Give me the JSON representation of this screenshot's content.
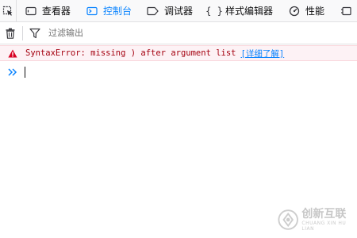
{
  "devtools": {
    "tabs": [
      {
        "id": "inspector",
        "label": "查看器",
        "icon": "inspector-icon",
        "selected": false
      },
      {
        "id": "console",
        "label": "控制台",
        "icon": "console-icon",
        "selected": true
      },
      {
        "id": "debugger",
        "label": "调试器",
        "icon": "debugger-icon",
        "selected": false
      },
      {
        "id": "style-editor",
        "label": "样式编辑器",
        "icon": "braces-icon",
        "selected": false
      },
      {
        "id": "performance",
        "label": "性能",
        "icon": "performance-icon",
        "selected": false
      }
    ],
    "accent_color": "#0a84ff"
  },
  "toolbar": {
    "filter_placeholder": "过滤输出"
  },
  "console": {
    "messages": [
      {
        "level": "error",
        "text": "SyntaxError: missing ) after argument list",
        "learn_more": "[详细了解]",
        "color": "#a4000f"
      }
    ],
    "prompt_symbol": "»"
  },
  "watermark": {
    "brand": "创新互联",
    "subtitle": "CHUANG XIN HU LIAN"
  }
}
